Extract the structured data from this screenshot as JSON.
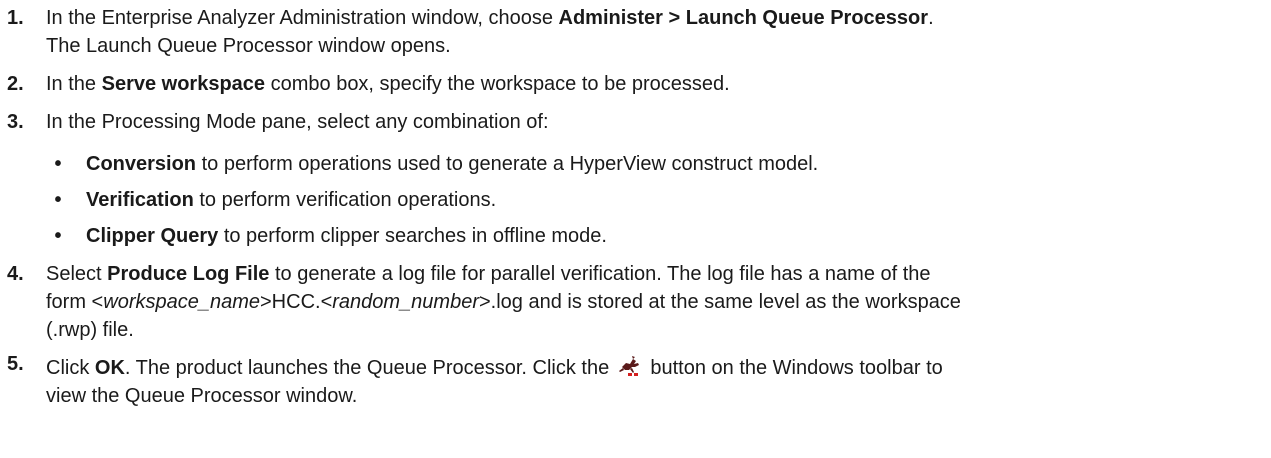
{
  "steps": [
    {
      "num": "1.",
      "line1_a": "In the Enterprise Analyzer Administration window, choose ",
      "line1_b": "Administer > Launch Queue Processor",
      "line1_c": ".",
      "line2": "The Launch Queue Processor window opens."
    },
    {
      "num": "2.",
      "a": "In the ",
      "b": "Serve workspace",
      "c": " combo box, specify the workspace to be processed."
    },
    {
      "num": "3.",
      "text": "In the Processing Mode pane, select any combination of:",
      "bullets": [
        {
          "term": "Conversion",
          "desc": " to perform operations used to generate a HyperView construct model."
        },
        {
          "term": "Verification",
          "desc": " to perform verification operations."
        },
        {
          "term": "Clipper Query",
          "desc": " to perform clipper searches in offline mode."
        }
      ]
    },
    {
      "num": "4.",
      "a": "Select ",
      "b": "Produce Log File",
      "c": " to generate a log file for parallel verification. The log file has a name of the",
      "d": "form <",
      "e": "workspace_name",
      "f": ">HCC.<",
      "g": "random_number",
      "h": ">.log and is stored at the same level as the workspace",
      "i": "(.rwp) file."
    },
    {
      "num": "5.",
      "a": "Click ",
      "b": "OK",
      "c": ". The product launches the Queue Processor. Click the ",
      "d": " button on the Windows toolbar to",
      "e": "view the Queue Processor window."
    }
  ],
  "bullet_glyph": "•",
  "icon": "queue-processor-icon",
  "colors": {
    "text": "#1a1a1a",
    "icon_body": "#5a1a1a",
    "icon_accent": "#d42020"
  }
}
